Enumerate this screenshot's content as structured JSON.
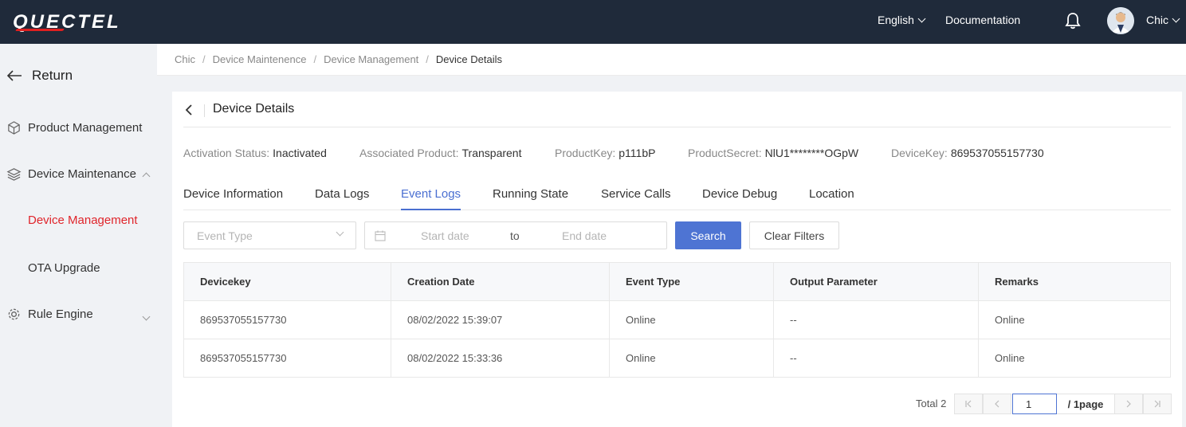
{
  "header": {
    "logo_text": "QUECTEL",
    "language": "English",
    "documentation": "Documentation",
    "username": "Chic"
  },
  "sidebar": {
    "return_label": "Return",
    "items": [
      {
        "label": "Product Management",
        "icon": "cube-icon"
      },
      {
        "label": "Device Maintenance",
        "icon": "layers-icon",
        "expanded": true
      },
      {
        "label": "Device Management",
        "active": true
      },
      {
        "label": "OTA Upgrade"
      },
      {
        "label": "Rule Engine",
        "icon": "gear-icon",
        "expanded": false
      }
    ]
  },
  "breadcrumb": [
    "Chic",
    "Device Maintenence",
    "Device Management",
    "Device Details"
  ],
  "page": {
    "title": "Device Details",
    "info": [
      {
        "label": "Activation Status:",
        "value": "Inactivated"
      },
      {
        "label": "Associated Product:",
        "value": "Transparent"
      },
      {
        "label": "ProductKey:",
        "value": "p111bP"
      },
      {
        "label": "ProductSecret:",
        "value": "NlU1********OGpW"
      },
      {
        "label": "DeviceKey:",
        "value": "869537055157730"
      }
    ],
    "tabs": [
      "Device Information",
      "Data Logs",
      "Event Logs",
      "Running State",
      "Service Calls",
      "Device Debug",
      "Location"
    ],
    "active_tab": "Event Logs"
  },
  "filters": {
    "event_type_placeholder": "Event Type",
    "start_placeholder": "Start date",
    "to_label": "to",
    "end_placeholder": "End date",
    "search_label": "Search",
    "clear_label": "Clear Filters"
  },
  "table": {
    "columns": [
      "Devicekey",
      "Creation Date",
      "Event Type",
      "Output Parameter",
      "Remarks"
    ],
    "rows": [
      [
        "869537055157730",
        "08/02/2022 15:39:07",
        "Online",
        "--",
        "Online"
      ],
      [
        "869537055157730",
        "08/02/2022 15:33:36",
        "Online",
        "--",
        "Online"
      ]
    ]
  },
  "pagination": {
    "total": "Total 2",
    "current_page": "1",
    "of_pages": "/ 1page"
  },
  "colors": {
    "topbar": "#1f2a3a",
    "accent": "#4e74d3",
    "active_nav": "#e0252b"
  }
}
